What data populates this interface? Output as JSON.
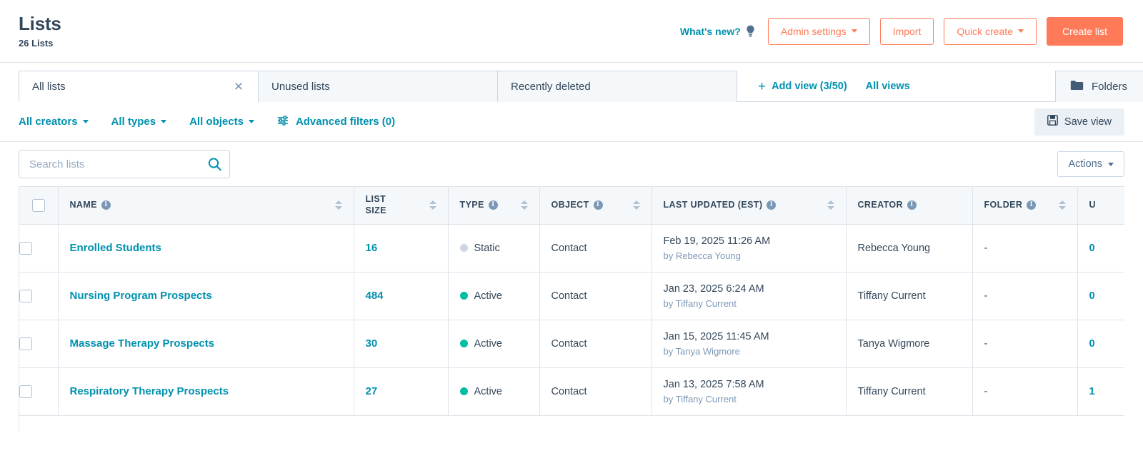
{
  "header": {
    "title": "Lists",
    "subtitle": "26 Lists",
    "whats_new": "What's new?",
    "whats_new_icon": "lightbulb-icon",
    "buttons": {
      "admin_settings": "Admin settings",
      "import": "Import",
      "quick_create": "Quick create",
      "create_list": "Create list"
    },
    "accent_color": "#ff7a59",
    "link_color": "#0091ae"
  },
  "views": {
    "tabs": [
      {
        "label": "All lists",
        "active": true,
        "closable": true
      },
      {
        "label": "Unused lists",
        "active": false,
        "closable": false
      },
      {
        "label": "Recently deleted",
        "active": false,
        "closable": false
      }
    ],
    "close_glyph": "✕",
    "add_view": "Add view (3/50)",
    "add_view_glyph": "+",
    "all_views": "All views",
    "folders": "Folders",
    "folders_icon": "folder-icon"
  },
  "filters": {
    "creators": "All creators",
    "types": "All types",
    "objects": "All objects",
    "advanced": "Advanced filters (0)",
    "advanced_icon": "sliders-icon",
    "save_view": "Save view",
    "save_view_icon": "save-disk-icon"
  },
  "search": {
    "placeholder": "Search lists",
    "value": "",
    "icon": "search-icon",
    "actions": "Actions"
  },
  "table": {
    "columns": [
      {
        "key": "check",
        "label": "",
        "info": false,
        "sortable": false
      },
      {
        "key": "name",
        "label": "NAME",
        "info": true,
        "sortable": true
      },
      {
        "key": "size",
        "label": "LIST SIZE",
        "info": false,
        "sortable": true
      },
      {
        "key": "type",
        "label": "TYPE",
        "info": true,
        "sortable": true
      },
      {
        "key": "object",
        "label": "OBJECT",
        "info": true,
        "sortable": true
      },
      {
        "key": "updated",
        "label": "LAST UPDATED (EST)",
        "info": true,
        "sortable": true
      },
      {
        "key": "creator",
        "label": "CREATOR",
        "info": true,
        "sortable": false
      },
      {
        "key": "folder",
        "label": "FOLDER",
        "info": true,
        "sortable": true
      },
      {
        "key": "used",
        "label": "U",
        "info": false,
        "sortable": false
      }
    ],
    "headers": {
      "name": "NAME",
      "list_size_line1": "LIST",
      "list_size_line2": "SIZE",
      "type": "TYPE",
      "object": "OBJECT",
      "updated": "LAST UPDATED (EST)",
      "creator": "CREATOR",
      "folder": "FOLDER",
      "used": "U"
    },
    "rows": [
      {
        "name": "Enrolled Students",
        "size": "16",
        "type": "Static",
        "type_state": "static",
        "object": "Contact",
        "updated_at": "Feb 19, 2025 11:26 AM",
        "updated_by": "by Rebecca Young",
        "creator": "Rebecca Young",
        "folder": "-",
        "used": "0"
      },
      {
        "name": "Nursing Program Prospects",
        "size": "484",
        "type": "Active",
        "type_state": "active",
        "object": "Contact",
        "updated_at": "Jan 23, 2025 6:24 AM",
        "updated_by": "by Tiffany Current",
        "creator": "Tiffany Current",
        "folder": "-",
        "used": "0"
      },
      {
        "name": "Massage Therapy Prospects",
        "size": "30",
        "type": "Active",
        "type_state": "active",
        "object": "Contact",
        "updated_at": "Jan 15, 2025 11:45 AM",
        "updated_by": "by Tanya Wigmore",
        "creator": "Tanya Wigmore",
        "folder": "-",
        "used": "0"
      },
      {
        "name": "Respiratory Therapy Prospects",
        "size": "27",
        "type": "Active",
        "type_state": "active",
        "object": "Contact",
        "updated_at": "Jan 13, 2025 7:58 AM",
        "updated_by": "by Tiffany Current",
        "creator": "Tiffany Current",
        "folder": "-",
        "used": "1"
      }
    ],
    "colors": {
      "active_dot": "#00bda5",
      "static_dot": "#cbd6e2",
      "link": "#0091ae",
      "header_bg": "#f5f8fa",
      "border": "#dfe3eb"
    }
  }
}
